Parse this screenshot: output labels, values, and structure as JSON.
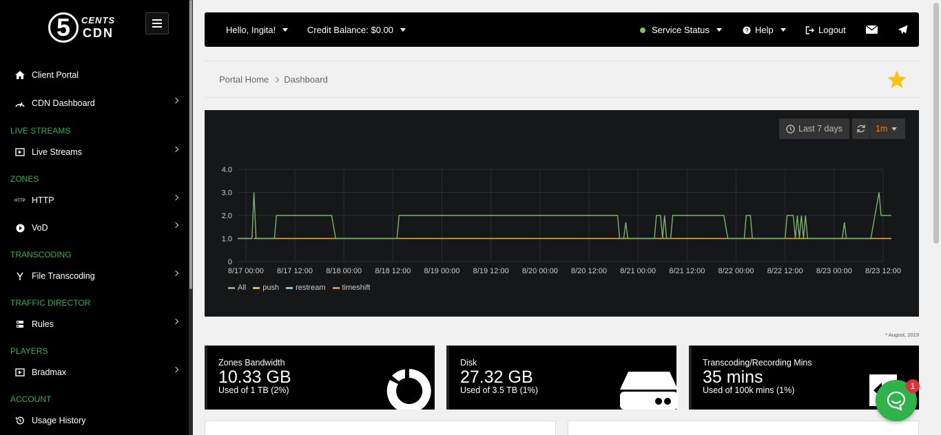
{
  "brand": {
    "logo_num": "5",
    "logo_top": "CENTS",
    "logo_bottom": "CDN"
  },
  "sidebar": {
    "items": [
      {
        "label": "Client Portal",
        "icon": "home-icon"
      },
      {
        "label": "CDN Dashboard",
        "icon": "speedometer-icon"
      },
      {
        "label": "Live Streams",
        "icon": "live-stream-icon"
      },
      {
        "label": "HTTP",
        "icon": "http-icon"
      },
      {
        "label": "VoD",
        "icon": "play-circle-icon"
      },
      {
        "label": "File Transcoding",
        "icon": "transcode-icon"
      },
      {
        "label": "Rules",
        "icon": "rules-icon"
      },
      {
        "label": "Bradmax",
        "icon": "player-icon"
      },
      {
        "label": "Usage History",
        "icon": "history-icon"
      }
    ],
    "sections": [
      "LIVE STREAMS",
      "ZONES",
      "TRANSCODING",
      "TRAFFIC DIRECTOR",
      "PLAYERS",
      "ACCOUNT"
    ]
  },
  "header": {
    "greeting": "Hello, Ingita!",
    "credit": "Credit Balance: $0.00",
    "service_status": "Service Status",
    "help": "Help",
    "logout": "Logout",
    "status_color": "#7cc54d"
  },
  "breadcrumb": {
    "home": "Portal Home",
    "current": "Dashboard"
  },
  "chart_controls": {
    "range": "Last 7 days",
    "refresh": "1m"
  },
  "chart_data": {
    "type": "line",
    "x_ticks": [
      "8/17 00:00",
      "8/17 12:00",
      "8/18 00:00",
      "8/18 12:00",
      "8/19 00:00",
      "8/19 12:00",
      "8/20 00:00",
      "8/20 12:00",
      "8/21 00:00",
      "8/21 12:00",
      "8/22 00:00",
      "8/22 12:00",
      "8/23 00:00",
      "8/23 12:00"
    ],
    "y_ticks": [
      "0",
      "1.0",
      "2.0",
      "3.0",
      "4.0"
    ],
    "ylim": [
      0,
      4
    ],
    "x_range_hours": [
      -2,
      156
    ],
    "grid": true,
    "legend_position": "bottom-left",
    "series": [
      {
        "name": "All",
        "color": "#7eb26d",
        "points": [
          [
            -2,
            1
          ],
          [
            1.5,
            1
          ],
          [
            2,
            3
          ],
          [
            2.5,
            1
          ],
          [
            7,
            1
          ],
          [
            7.5,
            2
          ],
          [
            21,
            2
          ],
          [
            22,
            1
          ],
          [
            37,
            1
          ],
          [
            37.5,
            2
          ],
          [
            91,
            2
          ],
          [
            91.5,
            1
          ],
          [
            92.5,
            1
          ],
          [
            93,
            1.7
          ],
          [
            93.5,
            1
          ],
          [
            100,
            1
          ],
          [
            100.5,
            2
          ],
          [
            101.5,
            2
          ],
          [
            102,
            1
          ],
          [
            102.5,
            2
          ],
          [
            103,
            1
          ],
          [
            104,
            1
          ],
          [
            104.5,
            2
          ],
          [
            117,
            2
          ],
          [
            118,
            1
          ],
          [
            122,
            1
          ],
          [
            122.5,
            2
          ],
          [
            123.5,
            2
          ],
          [
            124,
            1
          ],
          [
            132,
            1
          ],
          [
            132.5,
            2
          ],
          [
            134,
            2
          ],
          [
            134.5,
            1
          ],
          [
            135,
            2
          ],
          [
            135.5,
            1
          ],
          [
            136,
            2
          ],
          [
            136.5,
            1
          ],
          [
            137,
            2
          ],
          [
            137.5,
            1
          ],
          [
            146,
            1
          ],
          [
            146.5,
            1.7
          ],
          [
            147,
            1
          ],
          [
            153,
            1
          ],
          [
            154,
            2
          ],
          [
            155,
            3
          ],
          [
            155.5,
            2
          ],
          [
            158,
            2
          ]
        ]
      },
      {
        "name": "push",
        "color": "#eab839",
        "points": [
          [
            2,
            1
          ],
          [
            158,
            1
          ]
        ]
      },
      {
        "name": "restream",
        "color": "#6ed0e0",
        "points": [
          [
            -2,
            1
          ],
          [
            1.5,
            1
          ]
        ]
      },
      {
        "name": "timeshift",
        "color": "#ef843c",
        "points": []
      }
    ]
  },
  "note": "* August, 2019",
  "cards": [
    {
      "label": "Zones Bandwidth",
      "value": "10.33 GB",
      "sub": "Used of 1 TB (2%)"
    },
    {
      "label": "Disk",
      "value": "27.32 GB",
      "sub": "Used of 3.5 TB (1%)"
    },
    {
      "label": "Transcoding/Recording Mins",
      "value": "35 mins",
      "sub": "Used of 100k mins (1%)"
    }
  ],
  "chat_badge": "1"
}
